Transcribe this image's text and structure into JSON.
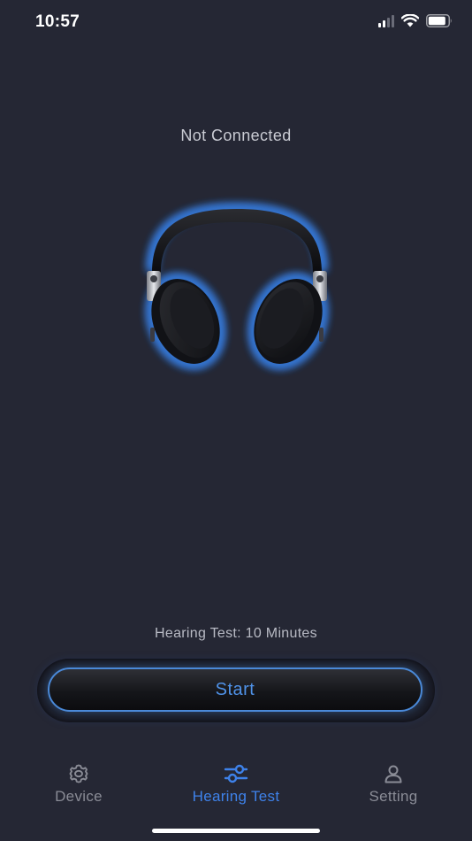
{
  "status_bar": {
    "time": "10:57"
  },
  "device": {
    "connection_status": "Not Connected",
    "image": "headphones-icon"
  },
  "hearing_test": {
    "duration_text": "Hearing Test: 10 Minutes",
    "start_label": "Start"
  },
  "tab_bar": {
    "items": [
      {
        "label": "Device",
        "icon": "gear-icon",
        "active": false
      },
      {
        "label": "Hearing Test",
        "icon": "sliders-icon",
        "active": true
      },
      {
        "label": "Setting",
        "icon": "person-icon",
        "active": false
      }
    ]
  },
  "colors": {
    "background": "#252734",
    "accent": "#3e82ea",
    "inactive": "#8a8c96",
    "glow": "#3a8cff"
  }
}
